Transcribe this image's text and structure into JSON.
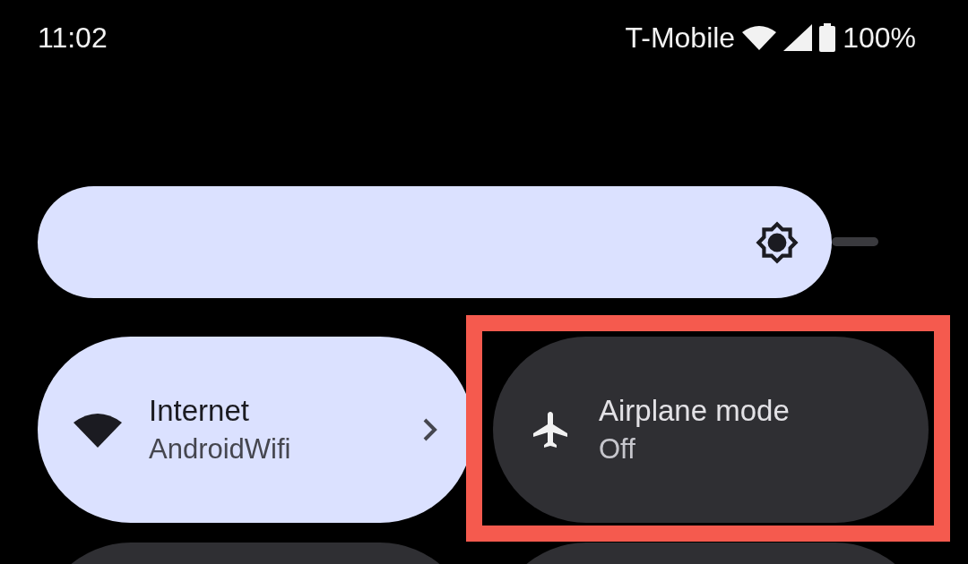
{
  "status_bar": {
    "time": "11:02",
    "carrier": "T-Mobile",
    "battery": "100%"
  },
  "brightness": {
    "level": 0.945
  },
  "tiles": [
    {
      "kind": "wifi",
      "title": "Internet",
      "subtitle": "AndroidWifi",
      "on": true,
      "chevron": true,
      "highlighted": false
    },
    {
      "kind": "airplane",
      "title": "Airplane mode",
      "subtitle": "Off",
      "on": false,
      "chevron": false,
      "highlighted": true
    }
  ],
  "partial_tiles": [
    {
      "on": false
    },
    {
      "on": false
    }
  ]
}
